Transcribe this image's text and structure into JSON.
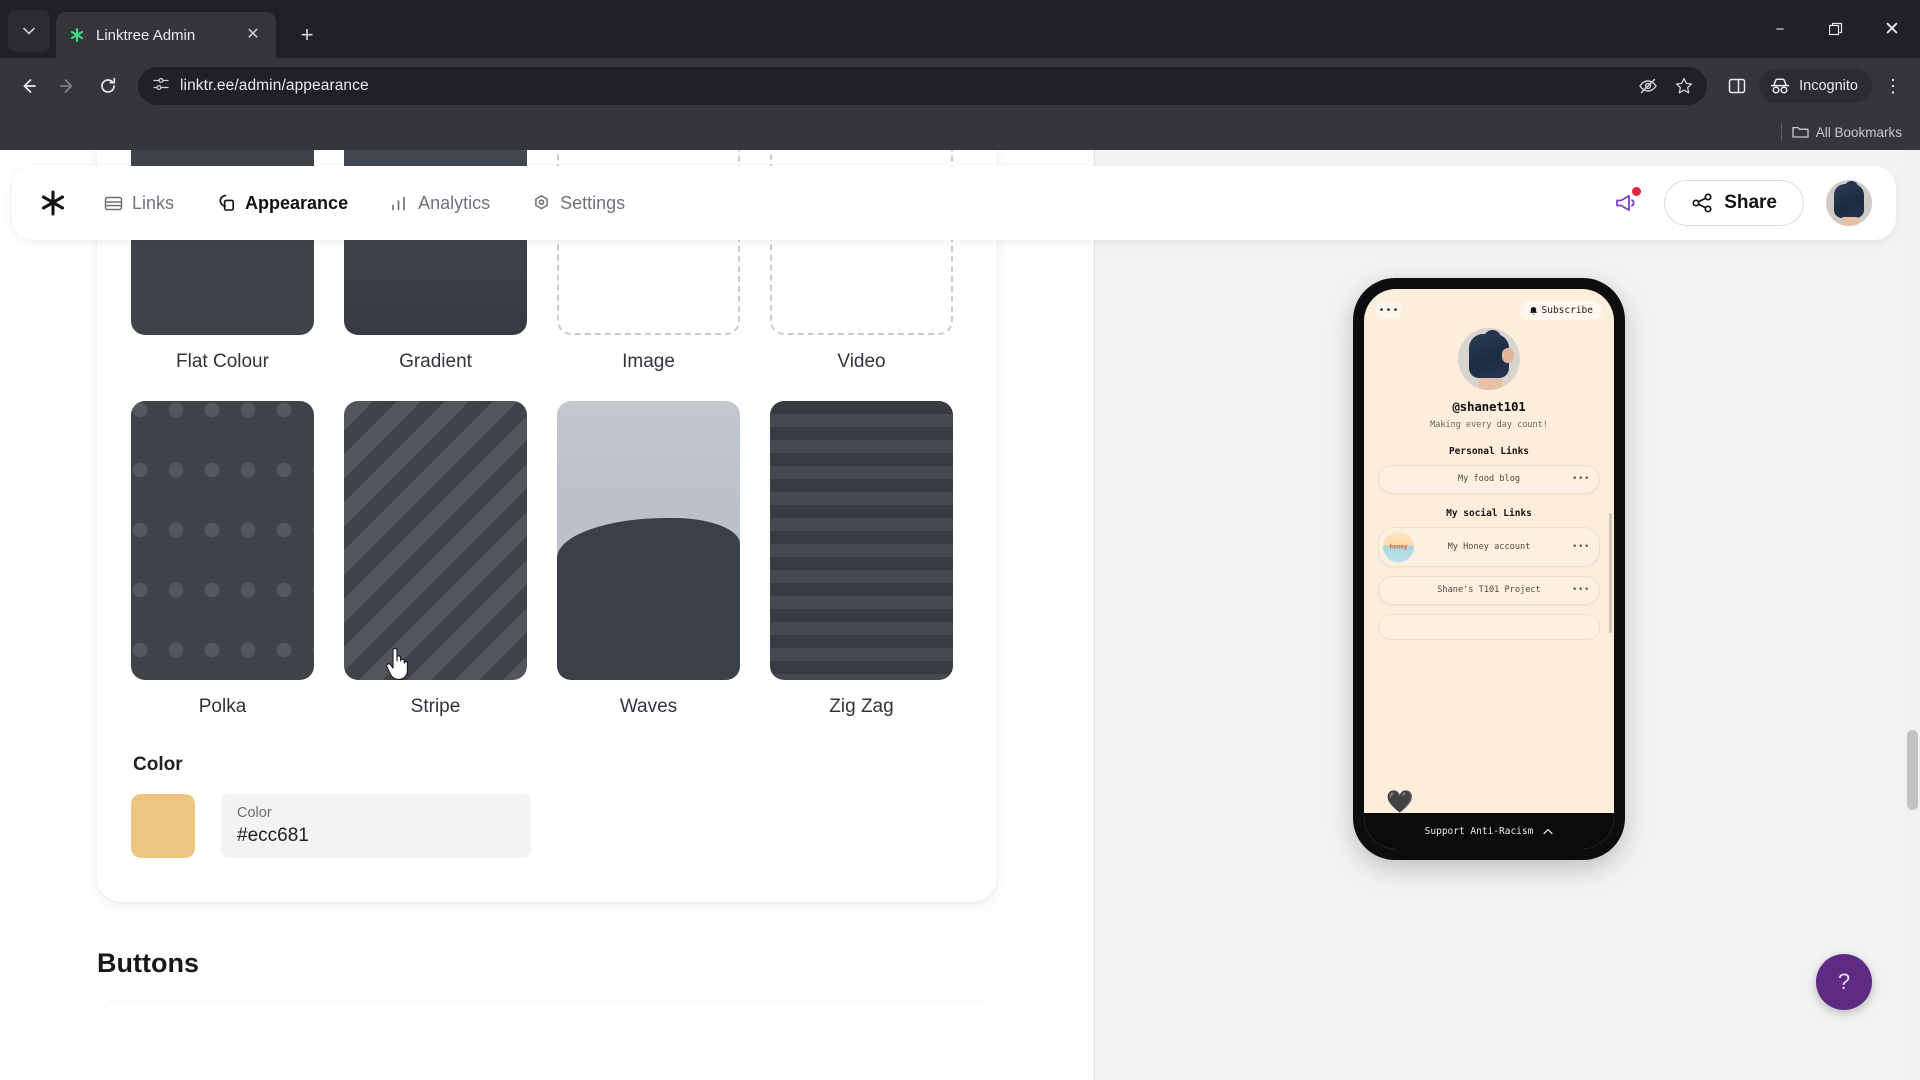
{
  "browser": {
    "tab": {
      "title": "Linktree Admin",
      "favicon": "linktree-asterisk-icon",
      "close": "✕"
    },
    "tab_list_chevron": "⌄",
    "new_tab": "+",
    "window": {
      "minimize": "−",
      "maximize": "❐",
      "close": "✕"
    },
    "nav": {
      "back": "←",
      "forward": "→",
      "reload": "⟳"
    },
    "address": {
      "url": "linktr.ee/admin/appearance",
      "site_info": "page-info-icon"
    },
    "omni_actions": {
      "tracking": "eye-slash-icon",
      "bookmark": "star-icon"
    },
    "side_panel": "side-panel-icon",
    "incognito_label": "Incognito",
    "menu": "⋮",
    "bookmarks": {
      "all_label": "All Bookmarks",
      "folder_icon": "folder-icon"
    }
  },
  "app": {
    "logo": "✳",
    "tabs": [
      {
        "label": "Links",
        "icon": "links-icon",
        "active": false
      },
      {
        "label": "Appearance",
        "icon": "appearance-icon",
        "active": true
      },
      {
        "label": "Analytics",
        "icon": "analytics-icon",
        "active": false
      },
      {
        "label": "Settings",
        "icon": "settings-icon",
        "active": false
      }
    ],
    "announcements_icon": "megaphone-icon",
    "share_label": "Share",
    "share_icon": "share-network-icon",
    "avatar": "user-avatar"
  },
  "background_section": {
    "styles": [
      {
        "label": "Flat Colour",
        "kind": "flat"
      },
      {
        "label": "Gradient",
        "kind": "gradient"
      },
      {
        "label": "Image",
        "kind": "empty"
      },
      {
        "label": "Video",
        "kind": "empty"
      },
      {
        "label": "Polka",
        "kind": "polka"
      },
      {
        "label": "Stripe",
        "kind": "stripe"
      },
      {
        "label": "Waves",
        "kind": "waves"
      },
      {
        "label": "Zig Zag",
        "kind": "zigzag"
      }
    ],
    "color": {
      "heading": "Color",
      "field_label": "Color",
      "value": "#ecc681",
      "swatch_hex": "#ecc681"
    }
  },
  "buttons_section": {
    "heading": "Buttons"
  },
  "preview": {
    "top_menu": "•••",
    "subscribe_label": "Subscribe",
    "subscribe_icon": "bell-icon",
    "username": "@shanet101",
    "bio": "Making every day count!",
    "groups": [
      {
        "title": "Personal Links",
        "links": [
          {
            "text": "My food blog",
            "kebab": "•••",
            "thumb": false
          }
        ]
      },
      {
        "title": "My social Links",
        "links": [
          {
            "text": "My Honey account",
            "kebab": "•••",
            "thumb": true,
            "thumb_label": "honey"
          },
          {
            "text": "Shane's T101 Project",
            "kebab": "•••",
            "thumb": false
          }
        ]
      }
    ],
    "banner": {
      "text": "Support Anti-Racism",
      "chevron": "⌃"
    }
  },
  "help": {
    "label": "?"
  }
}
